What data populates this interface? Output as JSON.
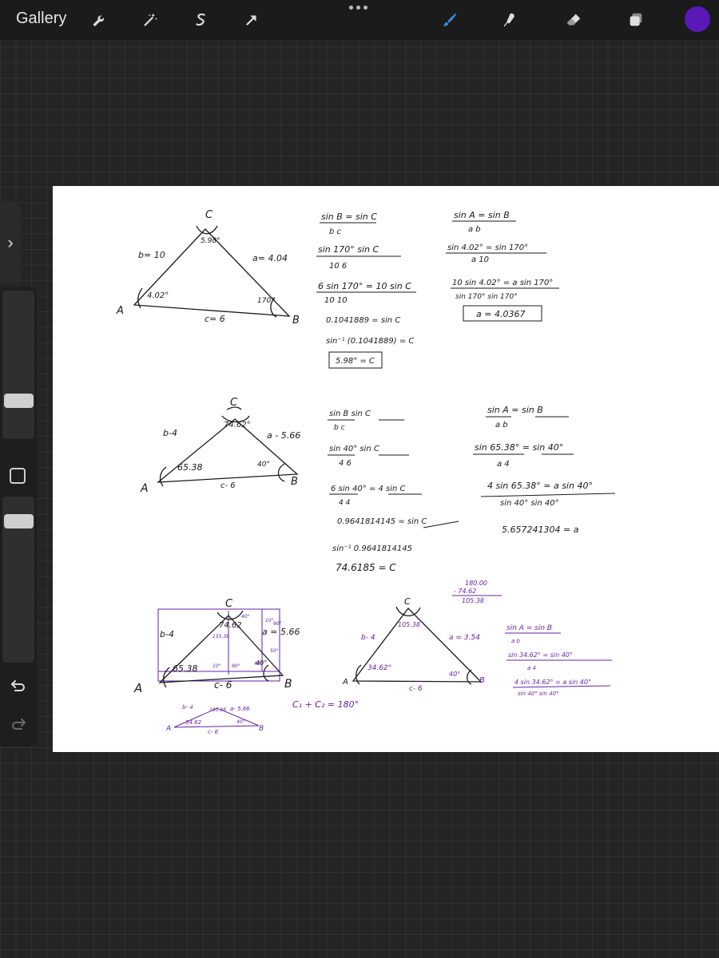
{
  "topbar": {
    "gallery_label": "Gallery",
    "tools_left": [
      "wrench-icon",
      "magic-wand-icon",
      "selection-icon",
      "transform-arrow-icon"
    ],
    "tools_right": [
      "brush-icon",
      "smudge-icon",
      "eraser-icon",
      "layers-icon"
    ],
    "active_color": "#5a18b8",
    "brush_color": "#3a8ee6"
  },
  "canvas": {
    "triangle1": {
      "vertex_a": "A",
      "vertex_b": "B",
      "vertex_c": "C",
      "side_b": "b= 10",
      "side_a": "a= 4.04",
      "side_c": "c= 6",
      "angle_c": "5.98°",
      "angle_a": "4.02°",
      "angle_b": "170°"
    },
    "work1_col1": {
      "r1_num": "sin B = sin C",
      "r1_den": "b          c",
      "r2_num": "sin 170°      sin C",
      "r2_den": "10               6",
      "r3_num": "6 sin 170°  =  10 sin C",
      "r3_den": "10                    10",
      "r4": "0.1041889 =  sin C",
      "r5": "sin⁻¹ (0.1041889) = C",
      "r6": "5.98° = C"
    },
    "work1_col2": {
      "r1_num": "sin A = sin B",
      "r1_den": "a         b",
      "r2_num": "sin 4.02°  =  sin 170°",
      "r2_den": "a                  10",
      "r3_num": "10 sin 4.02° = a sin 170°",
      "r3_den": "sin 170°          sin 170°",
      "r4": "a = 4.0367"
    },
    "triangle2": {
      "vertex_a": "A",
      "vertex_b": "B",
      "vertex_c": "C",
      "side_b": "b-4",
      "side_a": "a - 5.66",
      "side_c": "c- 6",
      "angle_c": "74.62°",
      "angle_a": "65.38",
      "angle_b": "40°"
    },
    "work2_col1": {
      "r1_num": "sin B      sin C",
      "r1_den": "b              c",
      "r2_num": "sin 40°      sin C",
      "r2_den": "4               6",
      "r3_num": "6 sin 40°  =  4 sin C",
      "r3_den": "4                  4",
      "r4": "0.9641814145 = sin C",
      "r5": "sin⁻¹ 0.9641814145",
      "r6": "74.6185 = C"
    },
    "work2_col2": {
      "r1_num": "sin A   =   sin B",
      "r1_den": "a              b",
      "r2_num": "sin 65.38°  =  sin 40°",
      "r2_den": "a                 4",
      "r3_num": "4 sin 65.38°  =  a sin 40°",
      "r3_den": "sin 40°            sin 40°",
      "r4": "5.657241304 = a"
    },
    "triangle3": {
      "vertex_a": "A",
      "vertex_b": "B",
      "vertex_c": "C",
      "side_b": "b-4",
      "side_a": "a = 5.66",
      "side_c": "c- 6",
      "angle_c": "74.62",
      "angle_a": "65.38",
      "angle_b": "40°",
      "inner_1": "155.38",
      "inner_2": "40°",
      "inner_3": "10°",
      "inner_4": "90°",
      "inner_5": "50°",
      "inner_6": "90°",
      "inner_7": "10°",
      "inner_8": "40°"
    },
    "triangle3_small": {
      "vertex_a": "A",
      "vertex_b": "B",
      "side_b": "b- 4",
      "side_a": "a- 5.66",
      "angle_c": "105.38",
      "angle_a": "34.62",
      "angle_b": "40°",
      "side_c": "c- 6"
    },
    "purple_note": "C₁ + C₂ = 180°",
    "triangle4": {
      "vertex_a": "A",
      "vertex_b": "B",
      "vertex_c": "C",
      "side_b": "b- 4",
      "side_a": "a = 3.54",
      "side_c": "c- 6",
      "angle_c": "105.38",
      "angle_a": "34.62°",
      "angle_b": "40°"
    },
    "subtraction": {
      "top": "180.00",
      "minus": "- 74.62",
      "result": "105.38"
    },
    "work4": {
      "r1_num": "sin A  =  sin B",
      "r1_den": "a            b",
      "r2_num": "sin 34.62°   =   sin 40°",
      "r2_den": "a                   4",
      "r3_num": "4 sin 34.62°  =  a sin 40°",
      "r3_den": "sin 40°           sin 40°"
    }
  }
}
